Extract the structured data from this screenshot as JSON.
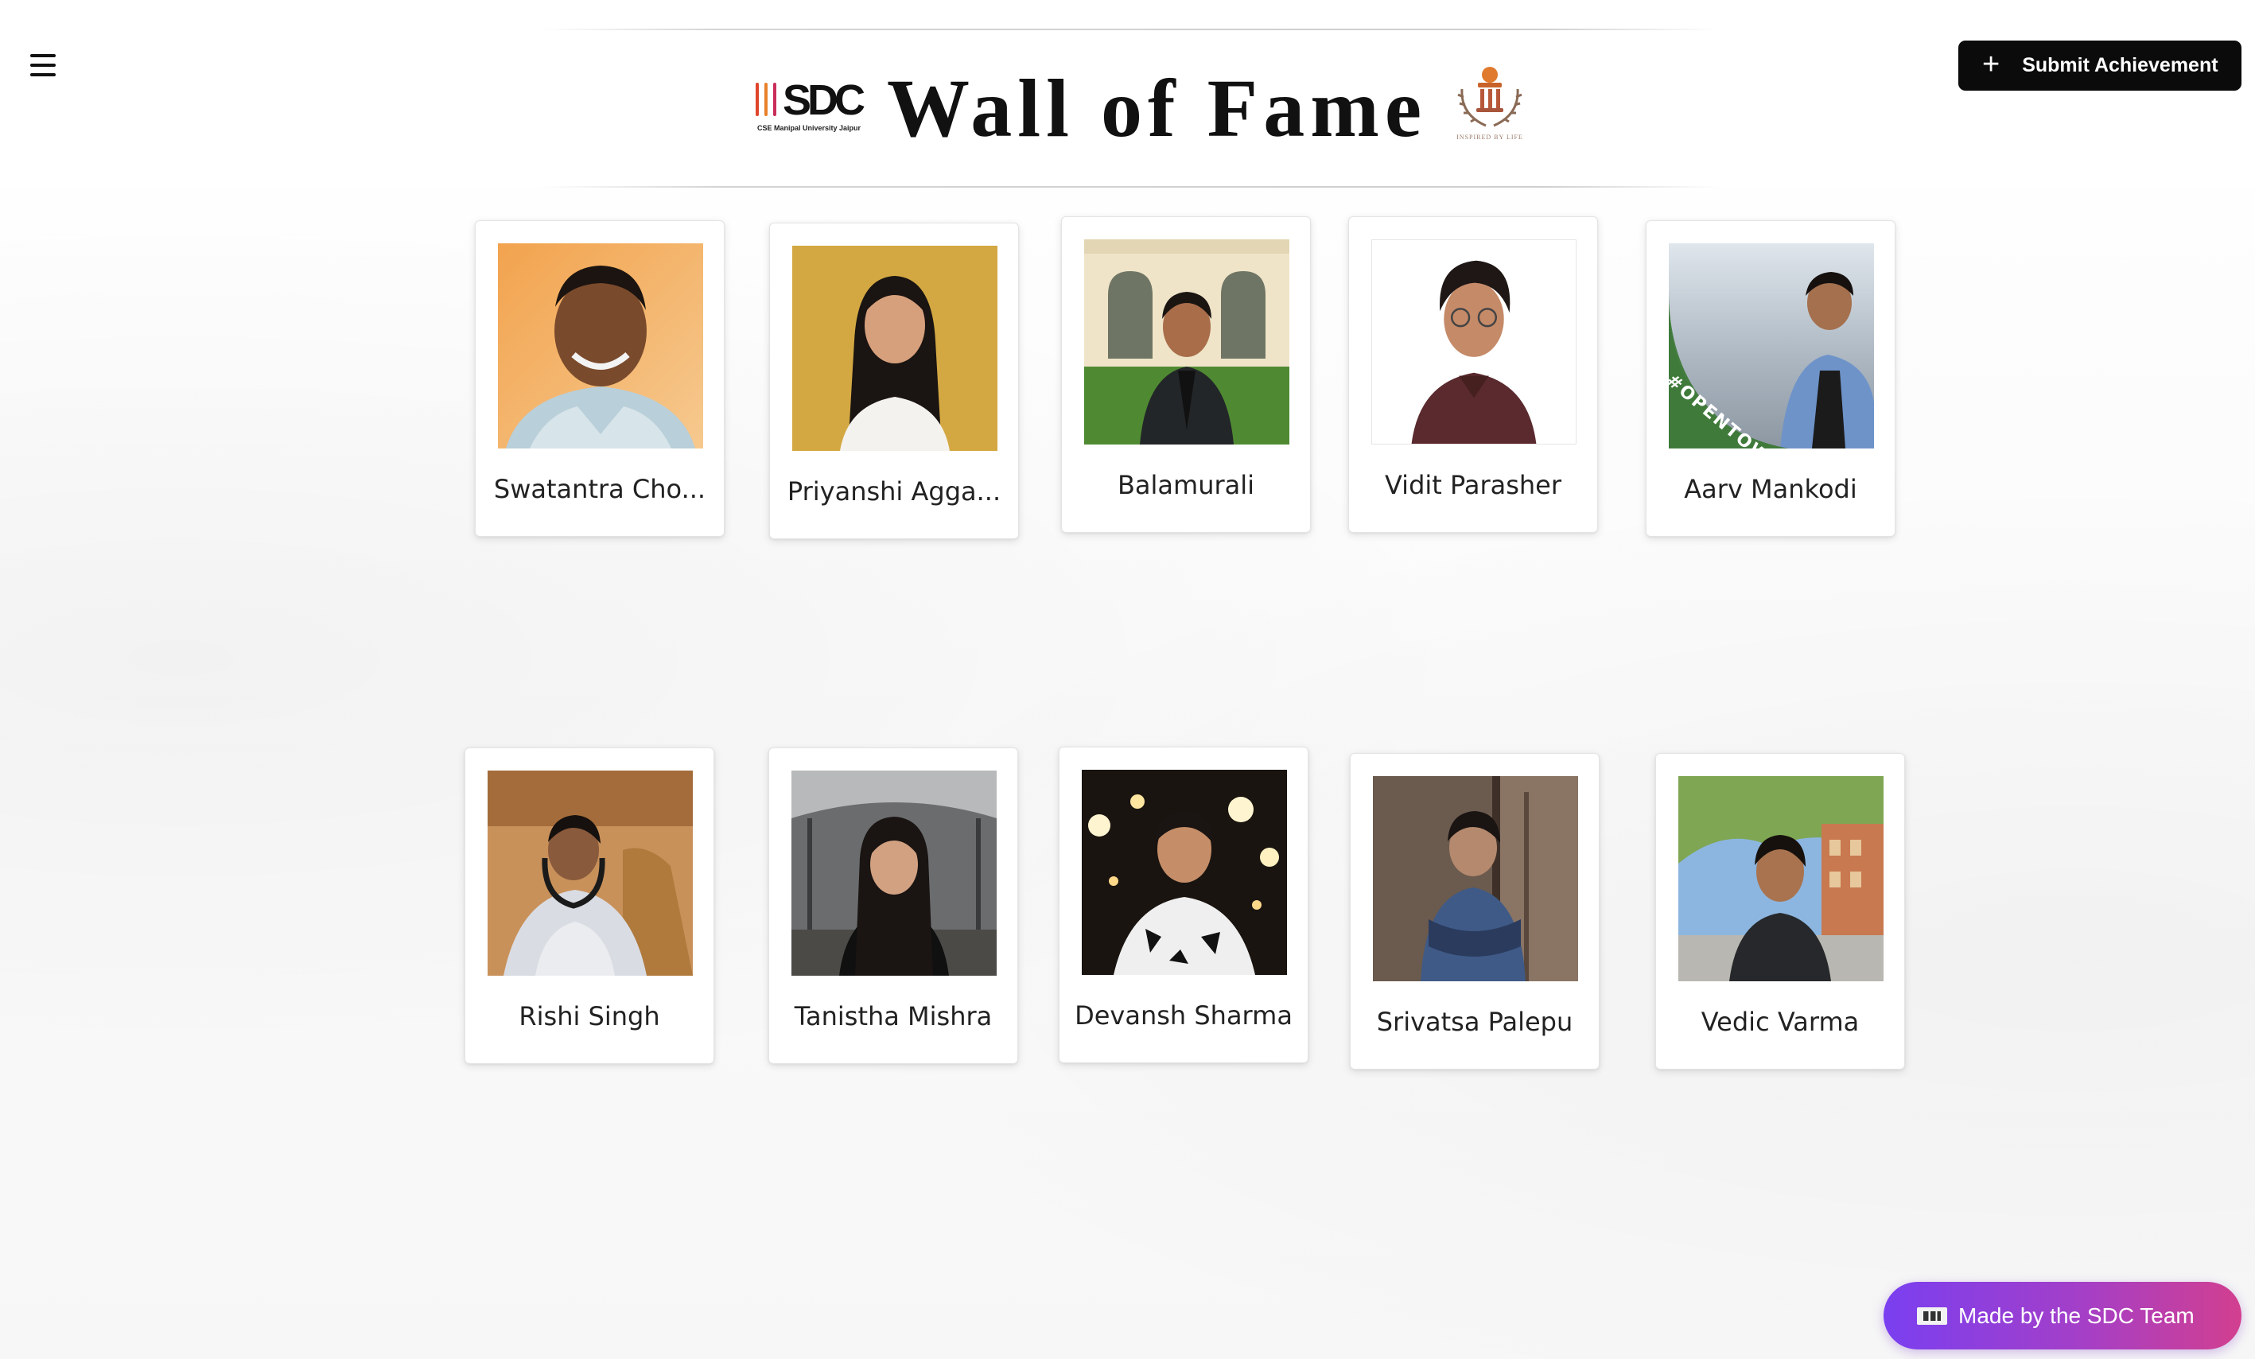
{
  "header": {
    "title": "Wall of Fame",
    "sdc_logo_text": "SDC",
    "sdc_logo_sub": "CSE Manipal University Jaipur",
    "emblem_tagline": "INSPIRED BY LIFE",
    "submit_label": "Submit Achievement",
    "submit_icon": "plus-icon",
    "menu_icon": "hamburger-icon"
  },
  "members": [
    {
      "name": "Swatantra Cho..."
    },
    {
      "name": "Priyanshi Agga..."
    },
    {
      "name": "Balamurali"
    },
    {
      "name": "Vidit Parasher"
    },
    {
      "name": "Aarv Mankodi"
    },
    {
      "name": "Rishi Singh"
    },
    {
      "name": "Tanistha Mishra"
    },
    {
      "name": "Devansh Sharma"
    },
    {
      "name": "Srivatsa Palepu"
    },
    {
      "name": "Vedic Varma"
    }
  ],
  "photo_overlay_text": "#OPENTOWORK",
  "footer": {
    "made_by_label": "Made by the SDC Team",
    "made_by_icon": "sdc-flag-icon"
  },
  "colors": {
    "submit_bg": "#0b0b0b",
    "made_by_gradient_start": "#7a3ff0",
    "made_by_gradient_end": "#d23f8f",
    "opentowork_green": "#3f7a3a"
  }
}
